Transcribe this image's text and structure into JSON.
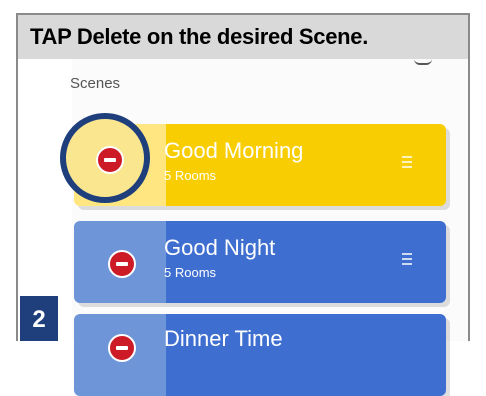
{
  "instruction": "TAP Delete on the desired Scene.",
  "section_title": "Scenes",
  "step_number": "2",
  "scenes": [
    {
      "name": "Good Morning",
      "rooms": "5 Rooms",
      "color": "#f8cd02",
      "highlighted": true
    },
    {
      "name": "Good Night",
      "rooms": "5 Rooms",
      "color": "#3e6fd0",
      "highlighted": false
    },
    {
      "name": "Dinner Time",
      "color": "#3e6fd0",
      "highlighted": false
    }
  ],
  "colors": {
    "header_bg": "#d9d9d9",
    "highlight_ring": "#1e3e7c",
    "delete_icon": "#cc1b26",
    "badge_bg": "#1e3e7c"
  },
  "icons": [
    "delete-icon",
    "drag-handle-icon"
  ]
}
